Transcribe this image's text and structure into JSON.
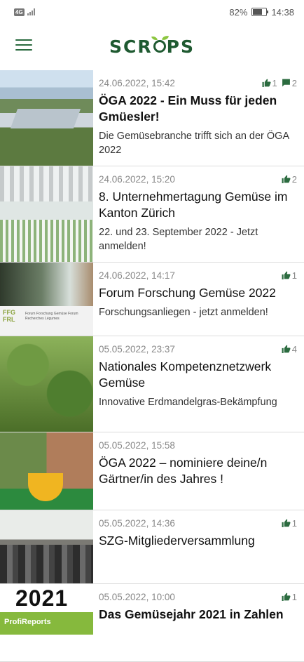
{
  "status_bar": {
    "carrier_badge": "4G",
    "battery": "82%",
    "battery_level": 0.82,
    "time": "14:38"
  },
  "app": {
    "logo": "SCROPS",
    "logo_parts": [
      "SCR",
      "PS"
    ]
  },
  "colors": {
    "brand": "#1f5a31",
    "accent": "#8cc63f"
  },
  "feed": [
    {
      "date": "24.06.2022, 15:42",
      "likes": "1",
      "comments": "2",
      "title": "ÖGA 2022 - Ein Muss für jeden Gmüesler!",
      "subtitle": "Die Gemüsebranche trifft sich an der ÖGA 2022"
    },
    {
      "date": "24.06.2022, 15:20",
      "likes": "2",
      "title": "8. Unternehmertagung Gemüse im Kanton Zürich",
      "subtitle": "22. und 23. September 2022 - Jetzt anmelden!"
    },
    {
      "date": "24.06.2022, 14:17",
      "likes": "1",
      "title": "Forum Forschung Gemüse 2022",
      "subtitle": "Forschungsanliegen - jetzt anmelden!",
      "thumb_logo": "FFG FRL",
      "thumb_text": "Forum Forschung Gemüse Forum Recherches Légumes"
    },
    {
      "date": "05.05.2022, 23:37",
      "likes": "4",
      "title": "Nationales Kompetenznetzwerk Gemüse",
      "subtitle": "Innovative Erdmandelgras-Bekämpfung"
    },
    {
      "date": "05.05.2022, 15:58",
      "title": "ÖGA 2022 – nominiere deine/n Gärtner/in des Jahres !"
    },
    {
      "date": "05.05.2022, 14:36",
      "likes": "1",
      "title": "SZG-Mitgliederversammlung"
    },
    {
      "date": "05.05.2022, 10:00",
      "likes": "1",
      "title": "Das Gemüsejahr 2021 in Zahlen",
      "thumb_year": "2021",
      "thumb_banner": "ProfiReports"
    }
  ]
}
